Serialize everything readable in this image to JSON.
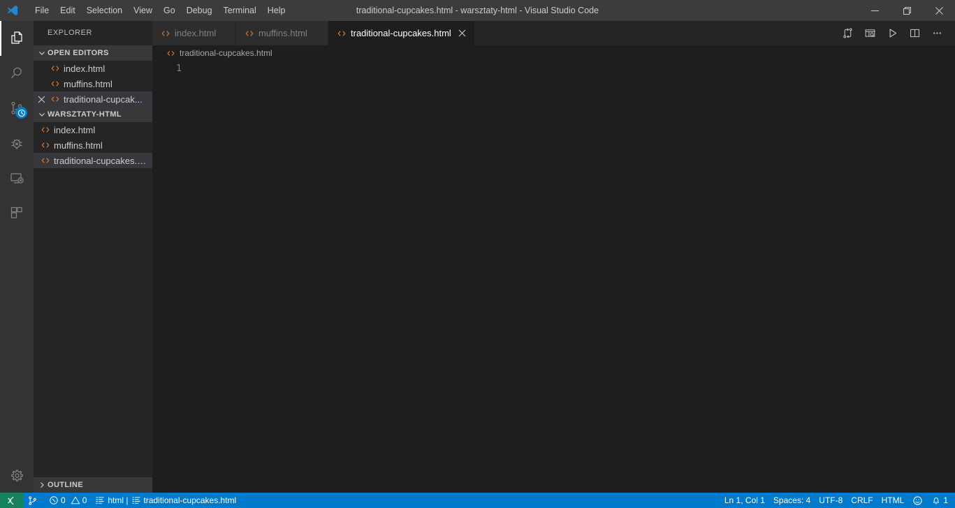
{
  "window": {
    "title": "traditional-cupcakes.html - warsztaty-html - Visual Studio Code",
    "logo": "vscode-logo-icon",
    "controls": {
      "minimize": "minimize-icon",
      "restore": "restore-icon",
      "close": "close-icon"
    }
  },
  "menubar": {
    "items": [
      {
        "label": "File"
      },
      {
        "label": "Edit"
      },
      {
        "label": "Selection"
      },
      {
        "label": "View"
      },
      {
        "label": "Go"
      },
      {
        "label": "Debug"
      },
      {
        "label": "Terminal"
      },
      {
        "label": "Help"
      }
    ]
  },
  "activitybar": {
    "items": [
      {
        "name": "explorer",
        "icon": "files-icon",
        "active": true,
        "badge": null
      },
      {
        "name": "search",
        "icon": "search-icon",
        "active": false,
        "badge": null
      },
      {
        "name": "source-control",
        "icon": "source-control-icon",
        "active": false,
        "badge": "clock"
      },
      {
        "name": "debug",
        "icon": "debug-icon",
        "active": false,
        "badge": null
      },
      {
        "name": "remote-explorer",
        "icon": "remote-explorer-icon",
        "active": false,
        "badge": null
      },
      {
        "name": "extensions",
        "icon": "extensions-icon",
        "active": false,
        "badge": null
      }
    ],
    "bottom": [
      {
        "name": "manage",
        "icon": "gear-icon"
      }
    ]
  },
  "sidebar": {
    "title": "EXPLORER",
    "open_editors": {
      "header": "OPEN EDITORS",
      "expanded": true,
      "items": [
        {
          "label": "index.html",
          "icon": "html-file-icon",
          "selected": false,
          "has_close": false
        },
        {
          "label": "muffins.html",
          "icon": "html-file-icon",
          "selected": false,
          "has_close": false
        },
        {
          "label": "traditional-cupcak...",
          "icon": "html-file-icon",
          "selected": true,
          "has_close": true
        }
      ]
    },
    "workspace": {
      "header": "WARSZTATY-HTML",
      "expanded": true,
      "items": [
        {
          "label": "index.html",
          "icon": "html-file-icon",
          "selected": false
        },
        {
          "label": "muffins.html",
          "icon": "html-file-icon",
          "selected": false
        },
        {
          "label": "traditional-cupcakes.h...",
          "icon": "html-file-icon",
          "selected": true
        }
      ]
    },
    "outline": {
      "header": "OUTLINE",
      "expanded": false
    }
  },
  "editor": {
    "tabs": [
      {
        "label": "index.html",
        "icon": "html-file-icon",
        "active": false,
        "closable": false
      },
      {
        "label": "muffins.html",
        "icon": "html-file-icon",
        "active": false,
        "closable": false
      },
      {
        "label": "traditional-cupcakes.html",
        "icon": "html-file-icon",
        "active": true,
        "closable": true
      }
    ],
    "actions": [
      {
        "name": "split-compare-icon",
        "title": "Compare"
      },
      {
        "name": "open-preview-icon",
        "title": "Open Preview"
      },
      {
        "name": "run-icon",
        "title": "Run"
      },
      {
        "name": "split-editor-icon",
        "title": "Split Editor"
      },
      {
        "name": "more-actions-icon",
        "title": "More Actions"
      }
    ],
    "breadcrumb": {
      "icon": "html-file-icon",
      "label": "traditional-cupcakes.html"
    },
    "lines": [
      {
        "number": "1",
        "text": ""
      }
    ]
  },
  "statusbar": {
    "remote_icon": "remote-window-icon",
    "left": [
      {
        "name": "branch",
        "icon": "source-control-icon",
        "label": ""
      },
      {
        "name": "problems",
        "icon": "error-warning-icon",
        "label": "0 ⚠ 0",
        "errors": "0",
        "warnings": "0"
      },
      {
        "name": "language-outline",
        "icon": "list-icon",
        "label": "html | ",
        "secondary_icon": "list-icon",
        "secondary_label": "traditional-cupcakes.html"
      }
    ],
    "right": [
      {
        "name": "cursor-position",
        "label": "Ln 1, Col 1"
      },
      {
        "name": "indentation",
        "label": "Spaces: 4"
      },
      {
        "name": "encoding",
        "label": "UTF-8"
      },
      {
        "name": "eol",
        "label": "CRLF"
      },
      {
        "name": "language-mode",
        "label": "HTML"
      },
      {
        "name": "feedback",
        "icon": "smiley-icon",
        "label": ""
      },
      {
        "name": "notifications",
        "icon": "bell-icon",
        "label": "1"
      }
    ]
  },
  "colors": {
    "titlebar_bg": "#3c3c3c",
    "activitybar_bg": "#333333",
    "sidebar_bg": "#252526",
    "editor_bg": "#1e1e1e",
    "tab_inactive_bg": "#2d2d2d",
    "statusbar_bg": "#007acc",
    "remote_bg": "#16825d",
    "accent": "#007acc",
    "html_icon": "#e37933",
    "selected_row": "#37373d",
    "section_header_bg": "#383838"
  }
}
